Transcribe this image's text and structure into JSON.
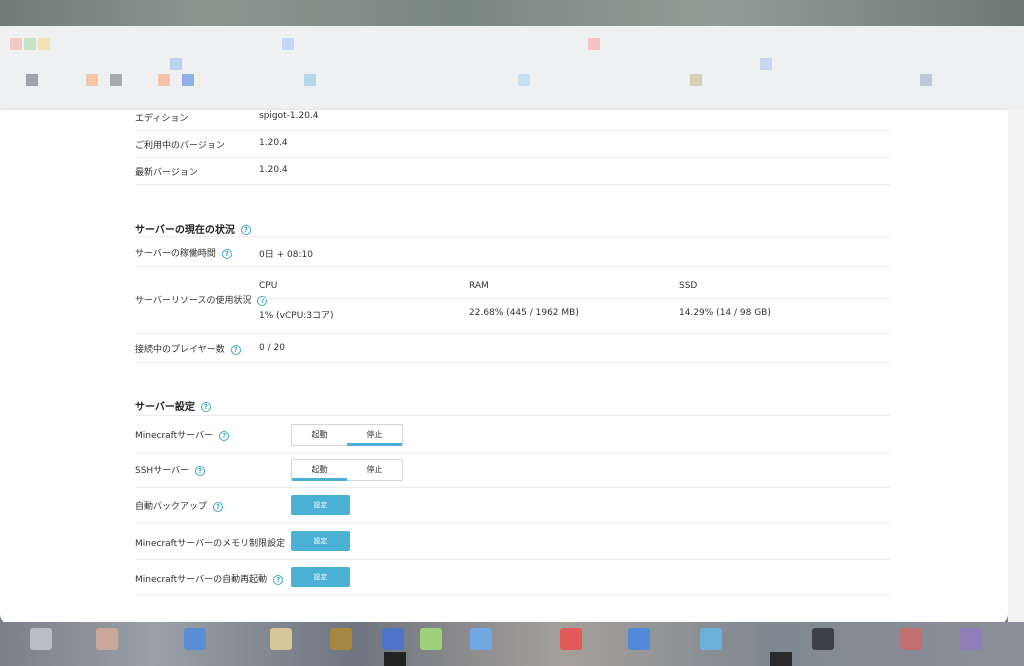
{
  "edition_info": {
    "rows": [
      {
        "label": "エディション",
        "value": "spigot-1.20.4"
      },
      {
        "label": "ご利用中のバージョン",
        "value": "1.20.4"
      },
      {
        "label": "最新バージョン",
        "value": "1.20.4"
      }
    ]
  },
  "status": {
    "title": "サーバーの現在の状況",
    "uptime_label": "サーバーの稼働時間",
    "uptime_value": "0日 + 08:10",
    "resources_label": "サーバーリソースの使用状況",
    "resources": [
      {
        "name": "CPU",
        "value": "1% (vCPU:3コア)"
      },
      {
        "name": "RAM",
        "value": "22.68% (445 / 1962 MB)"
      },
      {
        "name": "SSD",
        "value": "14.29% (14 / 98 GB)"
      }
    ],
    "players_label": "接続中のプレイヤー数",
    "players_value": "0 / 20"
  },
  "settings": {
    "title": "サーバー設定",
    "minecraft_label": "Minecraftサーバー",
    "ssh_label": "SSHサーバー",
    "toggle_start": "起動",
    "toggle_stop": "停止",
    "minecraft_state": "停止",
    "ssh_state": "起動",
    "backup_label": "自動バックアップ",
    "memory_label": "Minecraftサーバーのメモリ制限設定",
    "restart_label": "Minecraftサーバーの自動再起動",
    "set_button": "設定"
  },
  "help_glyph": "?",
  "colors": {
    "accent": "#4ab1d4",
    "help": "#3aa9cc"
  }
}
